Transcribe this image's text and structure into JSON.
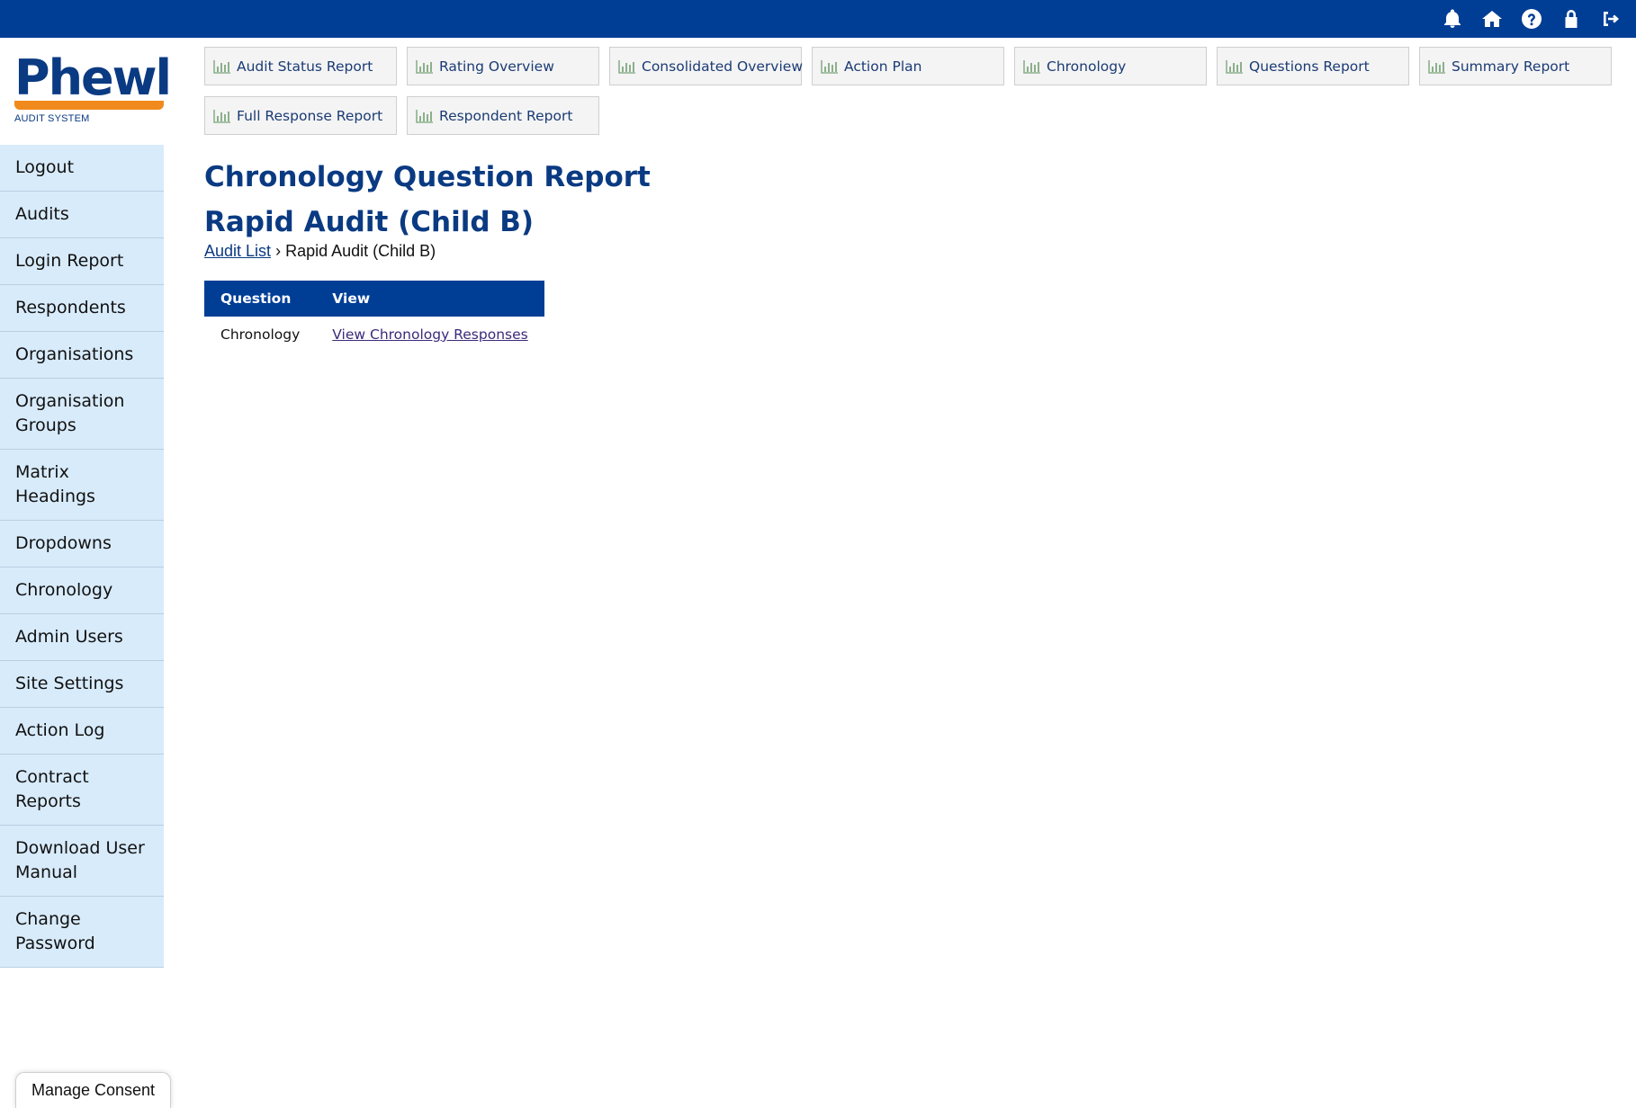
{
  "topbar": {
    "icons": [
      "bell-icon",
      "home-icon",
      "help-icon",
      "lock-icon",
      "sign-out-icon"
    ]
  },
  "logo": {
    "word": "Phewl",
    "subtitle": "AUDIT SYSTEM"
  },
  "sidebar": {
    "items": [
      {
        "label": "Logout"
      },
      {
        "label": "Audits"
      },
      {
        "label": "Login Report"
      },
      {
        "label": "Respondents"
      },
      {
        "label": "Organisations"
      },
      {
        "label": "Organisation Groups"
      },
      {
        "label": "Matrix Headings"
      },
      {
        "label": "Dropdowns"
      },
      {
        "label": "Chronology"
      },
      {
        "label": "Admin Users"
      },
      {
        "label": "Site Settings"
      },
      {
        "label": "Action Log"
      },
      {
        "label": "Contract Reports"
      },
      {
        "label": "Download User Manual"
      },
      {
        "label": "Change Password"
      }
    ]
  },
  "reports": {
    "buttons": [
      {
        "label": "Audit Status Report"
      },
      {
        "label": "Rating Overview"
      },
      {
        "label": "Consolidated Overview"
      },
      {
        "label": "Action Plan"
      },
      {
        "label": "Chronology"
      },
      {
        "label": "Questions Report"
      },
      {
        "label": "Summary Report"
      },
      {
        "label": "Full Response Report"
      },
      {
        "label": "Respondent Report"
      }
    ]
  },
  "page": {
    "title_line1": "Chronology Question Report",
    "title_line2": "Rapid Audit (Child B)"
  },
  "breadcrumb": {
    "link": "Audit List",
    "separator": "›",
    "current": "Rapid Audit (Child B)"
  },
  "table": {
    "headers": [
      "Question",
      "View"
    ],
    "rows": [
      {
        "question": "Chronology",
        "view": "View Chronology Responses"
      }
    ]
  },
  "consent": {
    "label": "Manage Consent"
  },
  "colors": {
    "primary": "#003e96",
    "sidebar_bg": "#d8ebfb",
    "logo_orange": "#f08a1c",
    "title": "#0a3a82"
  }
}
